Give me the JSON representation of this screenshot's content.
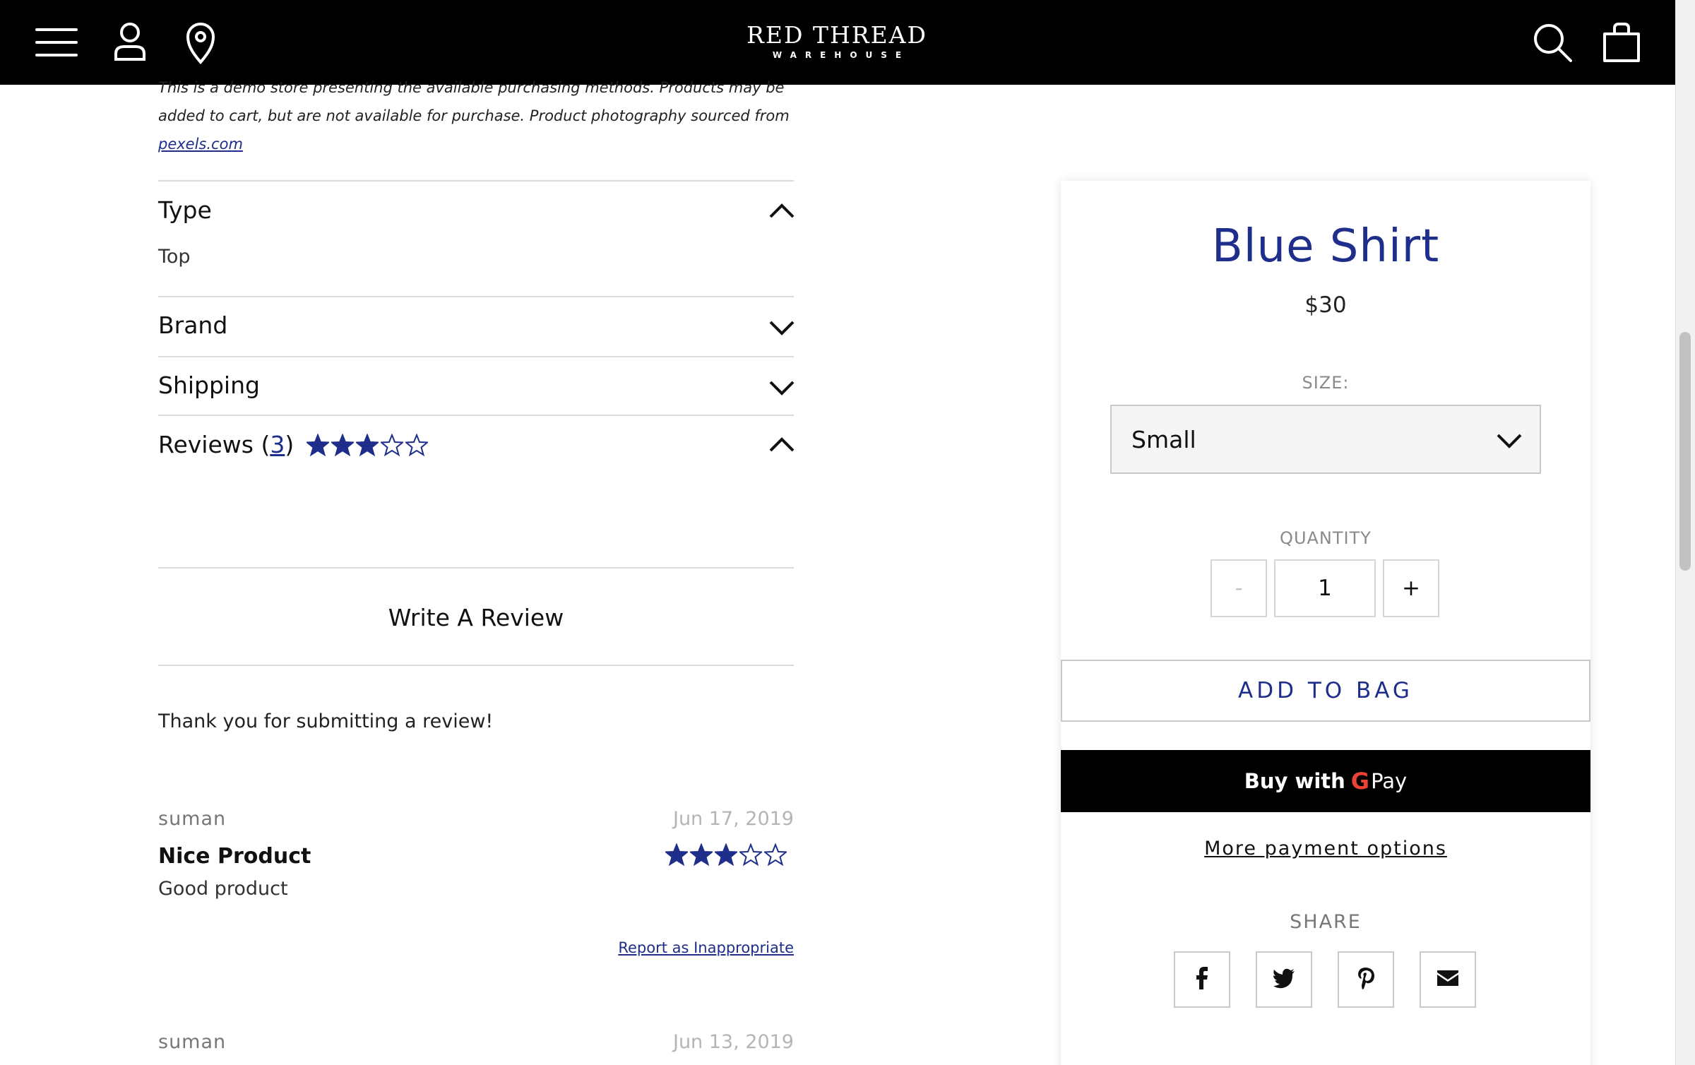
{
  "header": {
    "logo_main": "RED THREAD",
    "logo_sub": "WAREHOUSE"
  },
  "disclaimer": {
    "text_line1": "This is a demo store presenting the available purchasing methods. Products may be",
    "text_line2": "added to cart, but are not available for purchase. Product photography sourced from",
    "link": "pexels.com"
  },
  "accordions": {
    "type": {
      "title": "Type",
      "value": "Top",
      "state": "expanded"
    },
    "brand": {
      "title": "Brand",
      "state": "collapsed"
    },
    "shipping": {
      "title": "Shipping",
      "state": "collapsed"
    },
    "reviews": {
      "title": "Reviews",
      "paren_open": "(",
      "count": "3",
      "paren_close": ")",
      "rating": 3,
      "max_rating": 5,
      "state": "expanded"
    }
  },
  "reviews_section": {
    "write_review_label": "Write A Review",
    "thanks_message": "Thank you for submitting a review!",
    "items": [
      {
        "author": "suman",
        "date": "Jun 17, 2019",
        "title": "Nice Product",
        "body": "Good product",
        "rating": 3,
        "report_label": "Report as Inappropriate"
      },
      {
        "author": "suman",
        "date": "Jun 13, 2019"
      }
    ]
  },
  "product": {
    "title": "Blue Shirt",
    "price": "$30",
    "size_label": "SIZE:",
    "size_value": "Small",
    "quantity_label": "QUANTITY",
    "quantity_minus": "-",
    "quantity_value": "1",
    "quantity_plus": "+",
    "add_to_bag": "ADD TO BAG",
    "gpay_buy": "Buy with",
    "gpay_g": "G",
    "gpay_pay": "Pay",
    "more_payment": "More payment options",
    "share_label": "SHARE"
  },
  "colors": {
    "accent": "#1e2e8a",
    "header_bg": "#000000",
    "star": "#1e2e8a"
  },
  "icons": {
    "header_left": [
      "menu-icon",
      "account-icon",
      "location-icon"
    ],
    "header_right": [
      "search-icon",
      "bag-icon"
    ],
    "share": [
      "facebook-icon",
      "twitter-icon",
      "pinterest-icon",
      "email-icon"
    ]
  }
}
